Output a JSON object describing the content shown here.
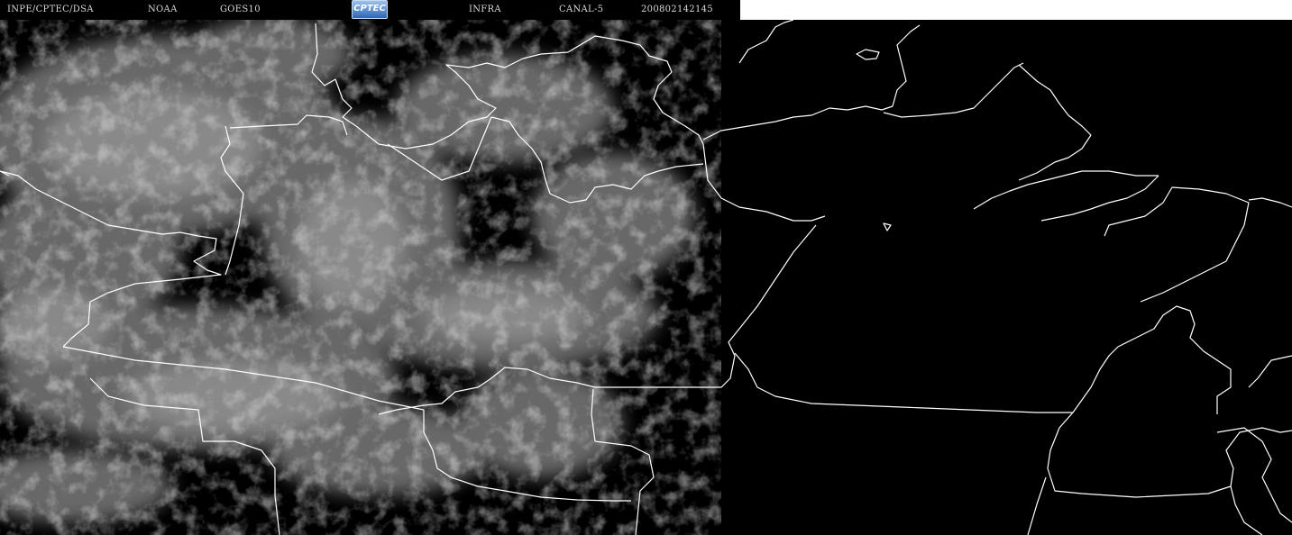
{
  "header": {
    "institution": "INPE/CPTEC/DSA",
    "agency": "NOAA",
    "satellite": "GOES10",
    "logo_text": "CPTEC",
    "band_type": "INFRA",
    "channel": "CANAL-5",
    "timestamp": "200802142145"
  },
  "colors": {
    "background": "#000000",
    "border_lines": "#ffffff",
    "clouds": "#b0b0b0",
    "header_text": "#d8d8d8",
    "header_blank": "#ffffff"
  },
  "map": {
    "type": "satellite-infrared-image",
    "border_style": "white outline"
  }
}
